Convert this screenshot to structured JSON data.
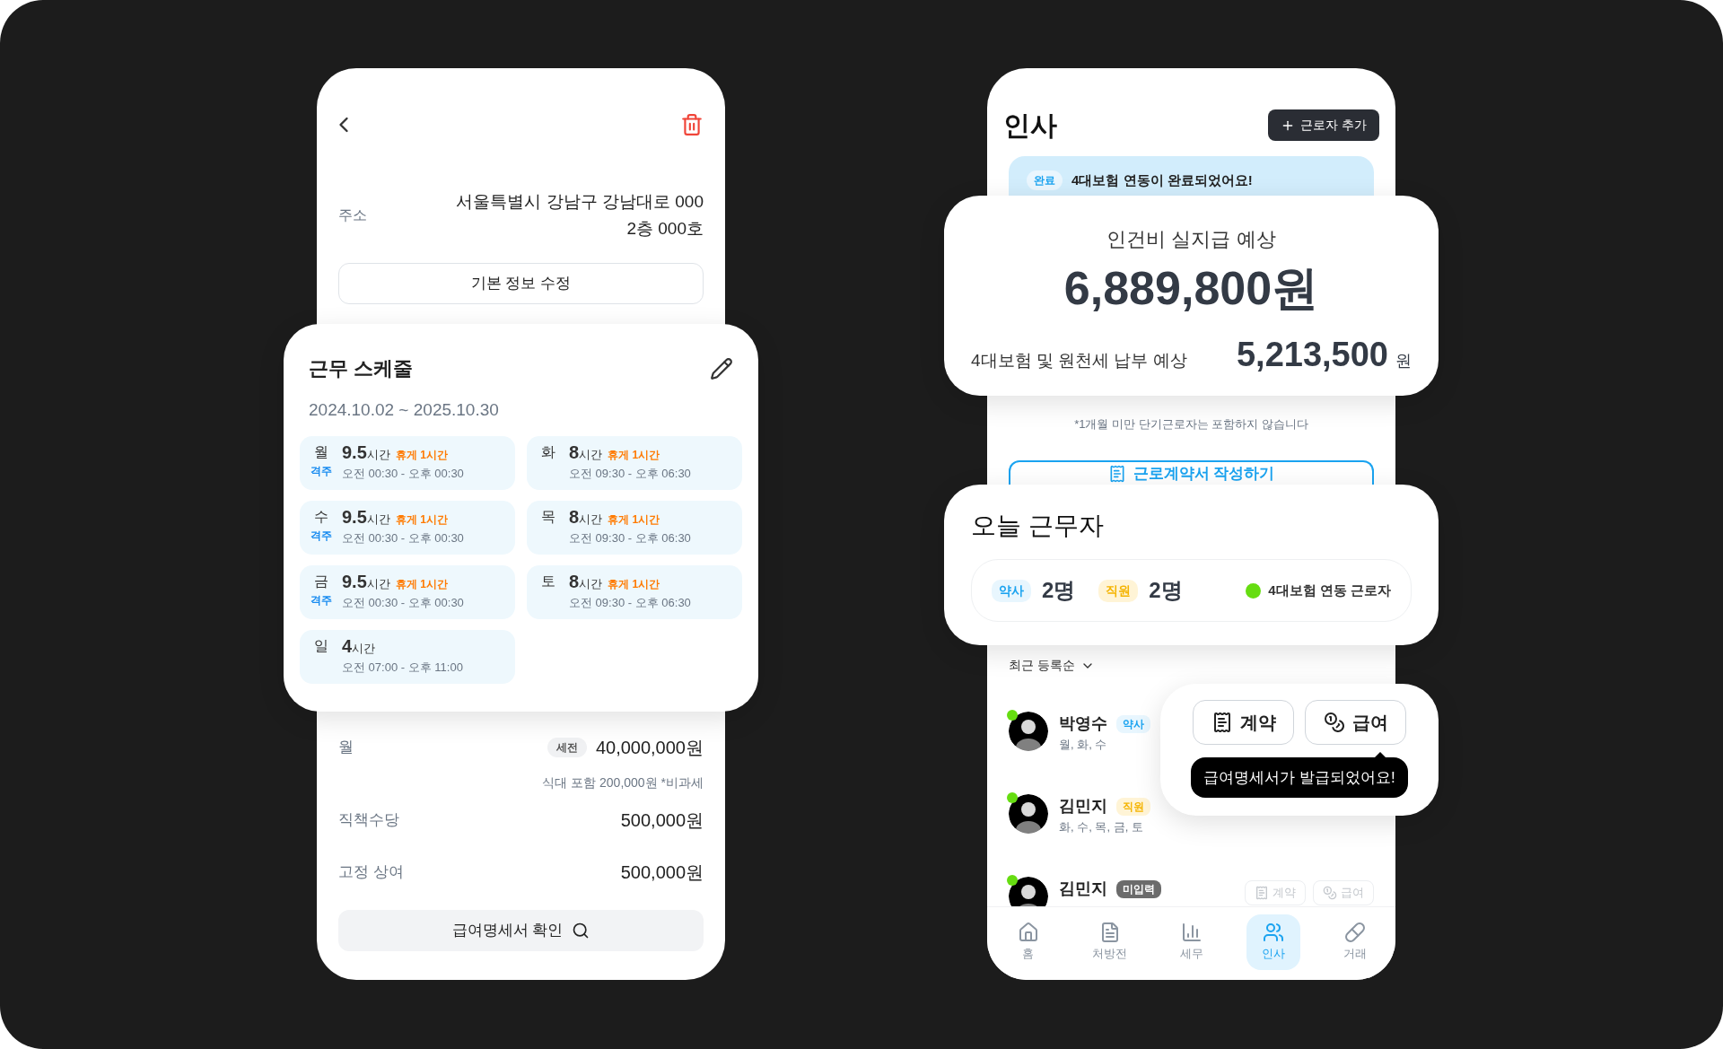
{
  "detail_screen": {
    "address_label": "주소",
    "address_lines": [
      "서울특별시 강남구 강남대로 000",
      "2층 000호"
    ],
    "edit_button": "기본 정보 수정",
    "salary_rows": [
      {
        "label": "월",
        "badge": "세전",
        "amount": "40,000,000원",
        "note": "식대 포함 200,000원 *비과세"
      },
      {
        "label": "직책수당",
        "amount": "500,000원"
      },
      {
        "label": "고정 상여",
        "amount": "500,000원"
      }
    ],
    "payslip_button": "급여명세서 확인"
  },
  "schedule_card": {
    "title": "근무 스케줄",
    "period": "2024.10.02 ~ 2025.10.30",
    "days": [
      {
        "day": "월",
        "hours": "9.5",
        "unit": "시간",
        "break": "휴게 1시간",
        "tag": "격주",
        "time": "오전 00:30 - 오후 00:30"
      },
      {
        "day": "화",
        "hours": "8",
        "unit": "시간",
        "break": "휴게 1시간",
        "time": "오전 09:30 - 오후 06:30"
      },
      {
        "day": "수",
        "hours": "9.5",
        "unit": "시간",
        "break": "휴게 1시간",
        "tag": "격주",
        "time": "오전 00:30 - 오후 00:30"
      },
      {
        "day": "목",
        "hours": "8",
        "unit": "시간",
        "break": "휴게 1시간",
        "time": "오전 09:30 - 오후 06:30"
      },
      {
        "day": "금",
        "hours": "9.5",
        "unit": "시간",
        "break": "휴게 1시간",
        "tag": "격주",
        "time": "오전 00:30 - 오후 00:30"
      },
      {
        "day": "토",
        "hours": "8",
        "unit": "시간",
        "break": "휴게 1시간",
        "time": "오전 09:30 - 오후 06:30"
      },
      {
        "day": "일",
        "hours": "4",
        "unit": "시간",
        "time": "오전 07:00 - 오후 11:00"
      }
    ]
  },
  "hr_screen": {
    "title": "인사",
    "add_button": "근로자 추가",
    "banner": {
      "badge": "완료",
      "text": "4대보험 연동이 완료되었어요!"
    },
    "note": "*1개월 미만 단기근로자는 포함하지 않습니다",
    "contract_button": "근로계약서 작성하기",
    "sort": "최근 등록순",
    "workers": [
      {
        "name": "박영수",
        "kind": "pharmacist",
        "role": "약사",
        "days": "월, 화, 수",
        "insured": true
      },
      {
        "name": "김민지",
        "kind": "staff",
        "role": "직원",
        "days": "화, 수, 목, 금, 토",
        "insured": true
      },
      {
        "name": "김민지",
        "kind": "missing",
        "role": "미입력",
        "insured": true,
        "actions": [
          {
            "kind": "contract",
            "label": "계약",
            "disabled": true
          },
          {
            "kind": "pay",
            "label": "급여",
            "disabled": true
          }
        ]
      }
    ],
    "nav": [
      {
        "kind": "home",
        "label": "홈",
        "selected": false
      },
      {
        "kind": "prescription",
        "label": "처방전",
        "selected": false
      },
      {
        "kind": "tax",
        "label": "세무",
        "selected": false
      },
      {
        "kind": "hr",
        "label": "인사",
        "selected": true
      },
      {
        "kind": "trade",
        "label": "거래",
        "selected": false
      }
    ]
  },
  "payroll_card": {
    "title": "인건비 실지급 예상",
    "amount": "6,889,800원",
    "tax_label": "4대보험 및 원천세 납부 예상",
    "tax_amount": "5,213,500",
    "tax_unit": "원"
  },
  "today_card": {
    "title": "오늘 근무자",
    "counts": [
      {
        "kind": "pharmacist",
        "label": "약사",
        "count": "2명"
      },
      {
        "kind": "staff",
        "label": "직원",
        "count": "2명"
      }
    ],
    "legend": "4대보험 연동 근로자"
  },
  "action_card": {
    "actions": [
      {
        "kind": "contract",
        "label": "계약",
        "disabled": false
      },
      {
        "kind": "pay",
        "label": "급여",
        "disabled": false
      }
    ],
    "tooltip": "급여명세서가 발급되었어요!"
  }
}
